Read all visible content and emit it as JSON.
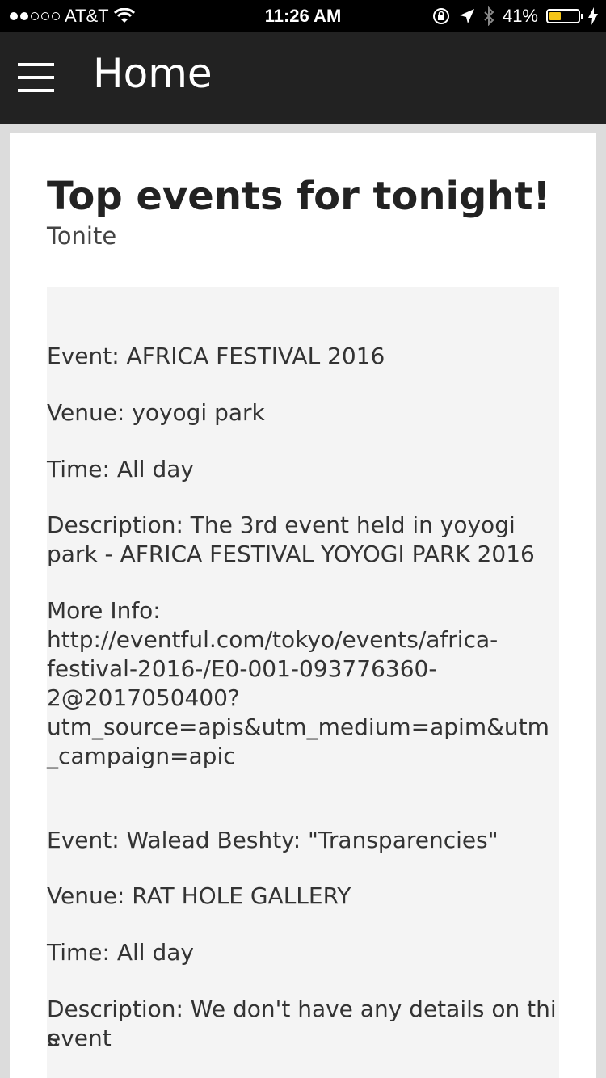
{
  "status_bar": {
    "signal": "●●○○○",
    "carrier": "AT&T",
    "wifi_icon": "wifi-icon",
    "time": "11:26 AM",
    "lock_icon": "rotation-lock-icon",
    "location_icon": "location-arrow-icon",
    "bluetooth_icon": "bluetooth-icon",
    "battery_percent": "41%",
    "battery_level": 0.41,
    "battery_color": "#f5c518",
    "charging_icon": "charging-bolt-icon"
  },
  "app_bar": {
    "menu_icon": "hamburger-menu-icon",
    "title": "Home"
  },
  "card": {
    "title": "Top events for tonight!",
    "subtitle": "Tonite"
  },
  "events": [
    {
      "event": "Event: AFRICA FESTIVAL 2016",
      "venue": "Venue: yoyogi park",
      "time": "Time: All day",
      "description_1": "Description: The 3rd event held in yoyogi",
      "description_2": "park - AFRICA FESTIVAL YOYOGI PARK 2016",
      "more_info_label": "More Info:",
      "url_1": "http://eventful.com/tokyo/events/africa-",
      "url_2": "festival-2016-/E0-001-093776360-",
      "url_3": "2@2017050400?",
      "url_4": "utm_source=apis&utm_medium=apim&utm",
      "url_5": "_campaign=apic"
    },
    {
      "event": "Event: Walead Beshty: \"Transparencies\"",
      "venue": "Venue: RAT HOLE GALLERY",
      "time": "Time: All day",
      "description_1": "Description: We don't have any details on this",
      "description_2": "event"
    }
  ]
}
